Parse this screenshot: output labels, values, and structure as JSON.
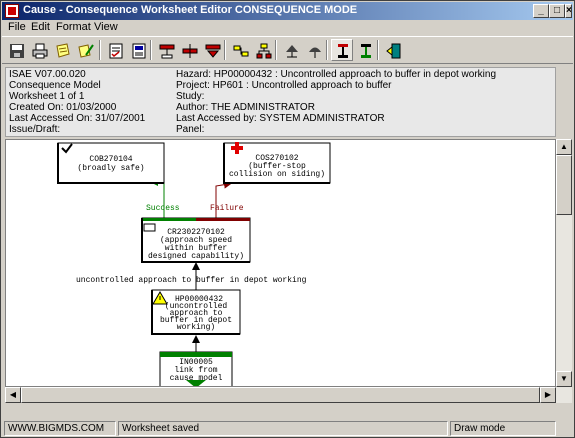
{
  "window": {
    "title": "Cause - Consequence Worksheet Editor CONSEQUENCE MODE",
    "min_glyph": "_",
    "max_glyph": "□",
    "close_glyph": "×"
  },
  "menu": [
    "File",
    "Edit",
    "Format",
    "View"
  ],
  "info": {
    "version": "ISAE V07.00.020",
    "model": "Consequence Model",
    "worksheet": "Worksheet 1 of 1",
    "created": "Created On: 01/03/2000",
    "last_accessed": "Last Accessed On: 31/07/2001",
    "issue": "Issue/Draft:",
    "hazard": "Hazard: HP00000432 : Uncontrolled approach to buffer in depot working",
    "project": "Project: HP601 : Uncontrolled approach to buffer",
    "study": "Study:",
    "author": "Author: THE ADMINISTRATOR",
    "last_accessed_by": "Last Accessed by: SYSTEM ADMINISTRATOR",
    "panel": "Panel:"
  },
  "diagram": {
    "success_label": "Success",
    "failure_label": "Failure",
    "link_label": "uncontrolled approach to buffer in depot working",
    "nodes": {
      "cob": [
        "COB270104",
        "(broadly safe)"
      ],
      "cos": [
        "COS270102",
        "(buffer-stop",
        "collision on siding)"
      ],
      "cr": [
        "CR2302270102",
        "(approach speed",
        "within buffer",
        "designed capability)"
      ],
      "hp": [
        "HP00000432",
        "(uncontrolled",
        "approach to",
        "buffer in depot",
        "working)"
      ],
      "in": [
        "IN00005",
        "link from",
        "cause model"
      ]
    },
    "colors": {
      "success": "#008000",
      "failure": "#800000",
      "link": "#000000"
    }
  },
  "status": {
    "website": "WWW.BIGMDS.COM",
    "message": "Worksheet saved",
    "mode": "Draw mode"
  }
}
